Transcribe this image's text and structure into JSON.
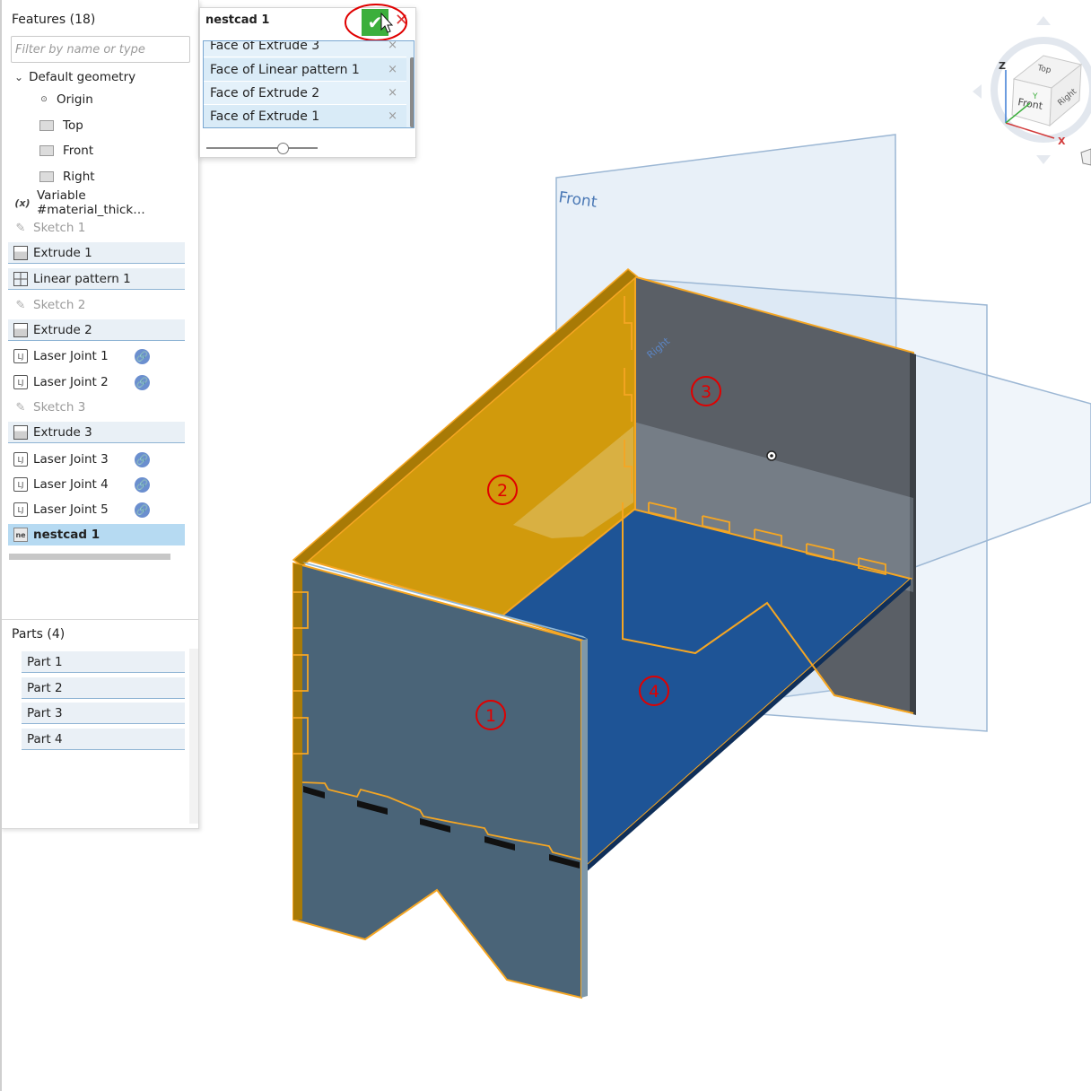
{
  "feature_tree": {
    "title": "Features (18)",
    "filter_placeholder": "Filter by name or type",
    "default_geometry_label": "Default geometry",
    "items": [
      {
        "label": "Origin",
        "icon": "origin-icon"
      },
      {
        "label": "Top",
        "icon": "plane-icon"
      },
      {
        "label": "Front",
        "icon": "plane-icon"
      },
      {
        "label": "Right",
        "icon": "plane-icon"
      },
      {
        "label": "Variable #material_thick…",
        "icon": "variable-icon",
        "icon_text": "(x)"
      },
      {
        "label": "Sketch 1",
        "icon": "sketch-icon",
        "state": "suppressed"
      },
      {
        "label": "Extrude 1",
        "icon": "extrude-icon"
      },
      {
        "label": "Linear pattern 1",
        "icon": "linear-pattern-icon"
      },
      {
        "label": "Sketch 2",
        "icon": "sketch-icon",
        "state": "suppressed"
      },
      {
        "label": "Extrude 2",
        "icon": "extrude-icon"
      },
      {
        "label": "Laser Joint 1",
        "icon": "laser-joint-icon",
        "icon_text": "LJ",
        "linked": true
      },
      {
        "label": "Laser Joint 2",
        "icon": "laser-joint-icon",
        "icon_text": "LJ",
        "linked": true
      },
      {
        "label": "Sketch 3",
        "icon": "sketch-icon",
        "state": "suppressed"
      },
      {
        "label": "Extrude 3",
        "icon": "extrude-icon"
      },
      {
        "label": "Laser Joint 3",
        "icon": "laser-joint-icon",
        "icon_text": "LJ",
        "linked": true
      },
      {
        "label": "Laser Joint 4",
        "icon": "laser-joint-icon",
        "icon_text": "LJ",
        "linked": true
      },
      {
        "label": "Laser Joint 5",
        "icon": "laser-joint-icon",
        "icon_text": "LJ",
        "linked": true
      },
      {
        "label": "nestcad 1",
        "icon": "nestcad-icon",
        "icon_text": "ne",
        "state": "selected"
      }
    ]
  },
  "parts": {
    "title": "Parts (4)",
    "items": [
      "Part 1",
      "Part 2",
      "Part 3",
      "Part 4"
    ]
  },
  "dialog": {
    "title": "nestcad 1",
    "selections": [
      "Face of Extrude 3",
      "Face of Linear pattern 1",
      "Face of Extrude 2",
      "Face of Extrude 1"
    ],
    "remove_glyph": "×"
  },
  "viewport": {
    "plane_labels": {
      "front": "Front",
      "right": "Right"
    },
    "callouts": [
      "1",
      "2",
      "3",
      "4"
    ],
    "view_cube": {
      "face_top": "Top",
      "face_front": "Front",
      "face_right": "Right",
      "axis_x": "X",
      "axis_y": "Y",
      "axis_z": "Z"
    }
  },
  "colors": {
    "selection_orange": "#f5a623",
    "part_gray_blue": "#4a6478",
    "part_blue": "#1e5496",
    "part_yellow": "#d19a0c",
    "part_dark_gray": "#5a5f66",
    "accept_green": "#3caf3c",
    "annotation_red": "#e00000"
  }
}
